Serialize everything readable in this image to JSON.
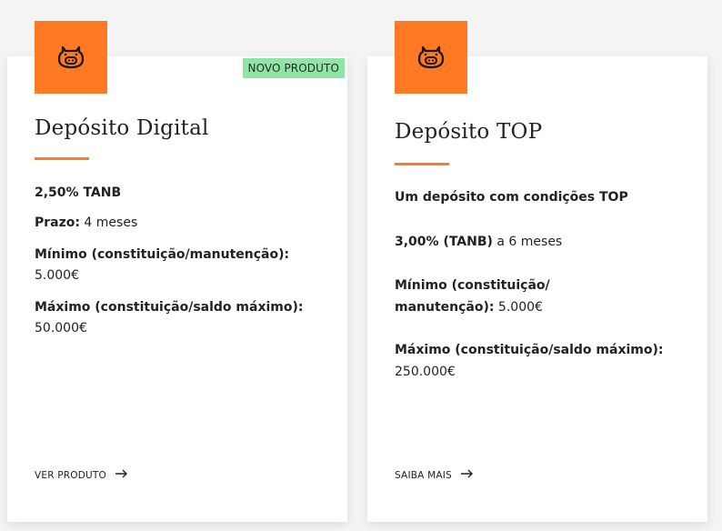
{
  "cards": [
    {
      "badge": "NOVO PRODUTO",
      "title": "Depósito Digital",
      "tanb": "2,50% TANB",
      "prazo_label": "Prazo:",
      "prazo_value": " 4 meses",
      "min_label": "Mínimo (constituição/manutenção):",
      "min_value": "5.000€",
      "max_label": "Máximo (constituição/saldo máximo):",
      "max_value": "50.000€",
      "cta": "VER PRODUTO"
    },
    {
      "title": "Depósito TOP",
      "desc": "Um depósito com condições TOP",
      "rate_bold": "3,00% (TANB)",
      "rate_rest": " a 6 meses",
      "min_label_1": "Mínimo (constituição/",
      "min_label_2": "manutenção):",
      "min_value": " 5.000€",
      "max_label": "Máximo (constituição/saldo máximo):",
      "max_value": "250.000€",
      "cta": "SAIBA MAIS"
    }
  ],
  "colors": {
    "accent": "#ff7a22",
    "badge_bg": "#8fe4a6"
  },
  "icons": {
    "card_icon": "piggy-bank-icon",
    "cta_icon": "arrow-right-icon"
  }
}
